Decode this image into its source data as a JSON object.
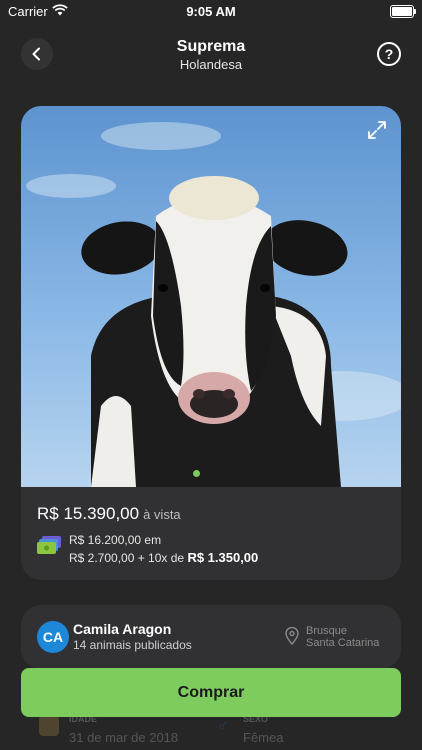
{
  "status_bar": {
    "carrier": "Carrier",
    "time": "9:05 AM"
  },
  "header": {
    "title": "Suprema",
    "subtitle": "Holandesa"
  },
  "product": {
    "image": "holstein-cow-photo",
    "price": "R$ 15.390,00",
    "price_suffix": "à vista",
    "installment_line1": "R$ 16.200,00 em",
    "installment_line2_prefix": "R$ 2.700,00 + 10x de ",
    "installment_line2_amount": "R$ 1.350,00"
  },
  "seller": {
    "initials": "CA",
    "name": "Camila Aragon",
    "count": "14 animais publicados",
    "city": "Brusque",
    "state": "Santa Catarina"
  },
  "details": {
    "age_label": "IDADE",
    "age_value": "31 de mar de 2018",
    "sex_label": "SEXO",
    "sex_value": "Fêmea"
  },
  "buy_button": "Comprar",
  "colors": {
    "accent": "#7ecb5e",
    "background": "#262627",
    "card": "#313133",
    "avatar": "#1e88d8"
  }
}
